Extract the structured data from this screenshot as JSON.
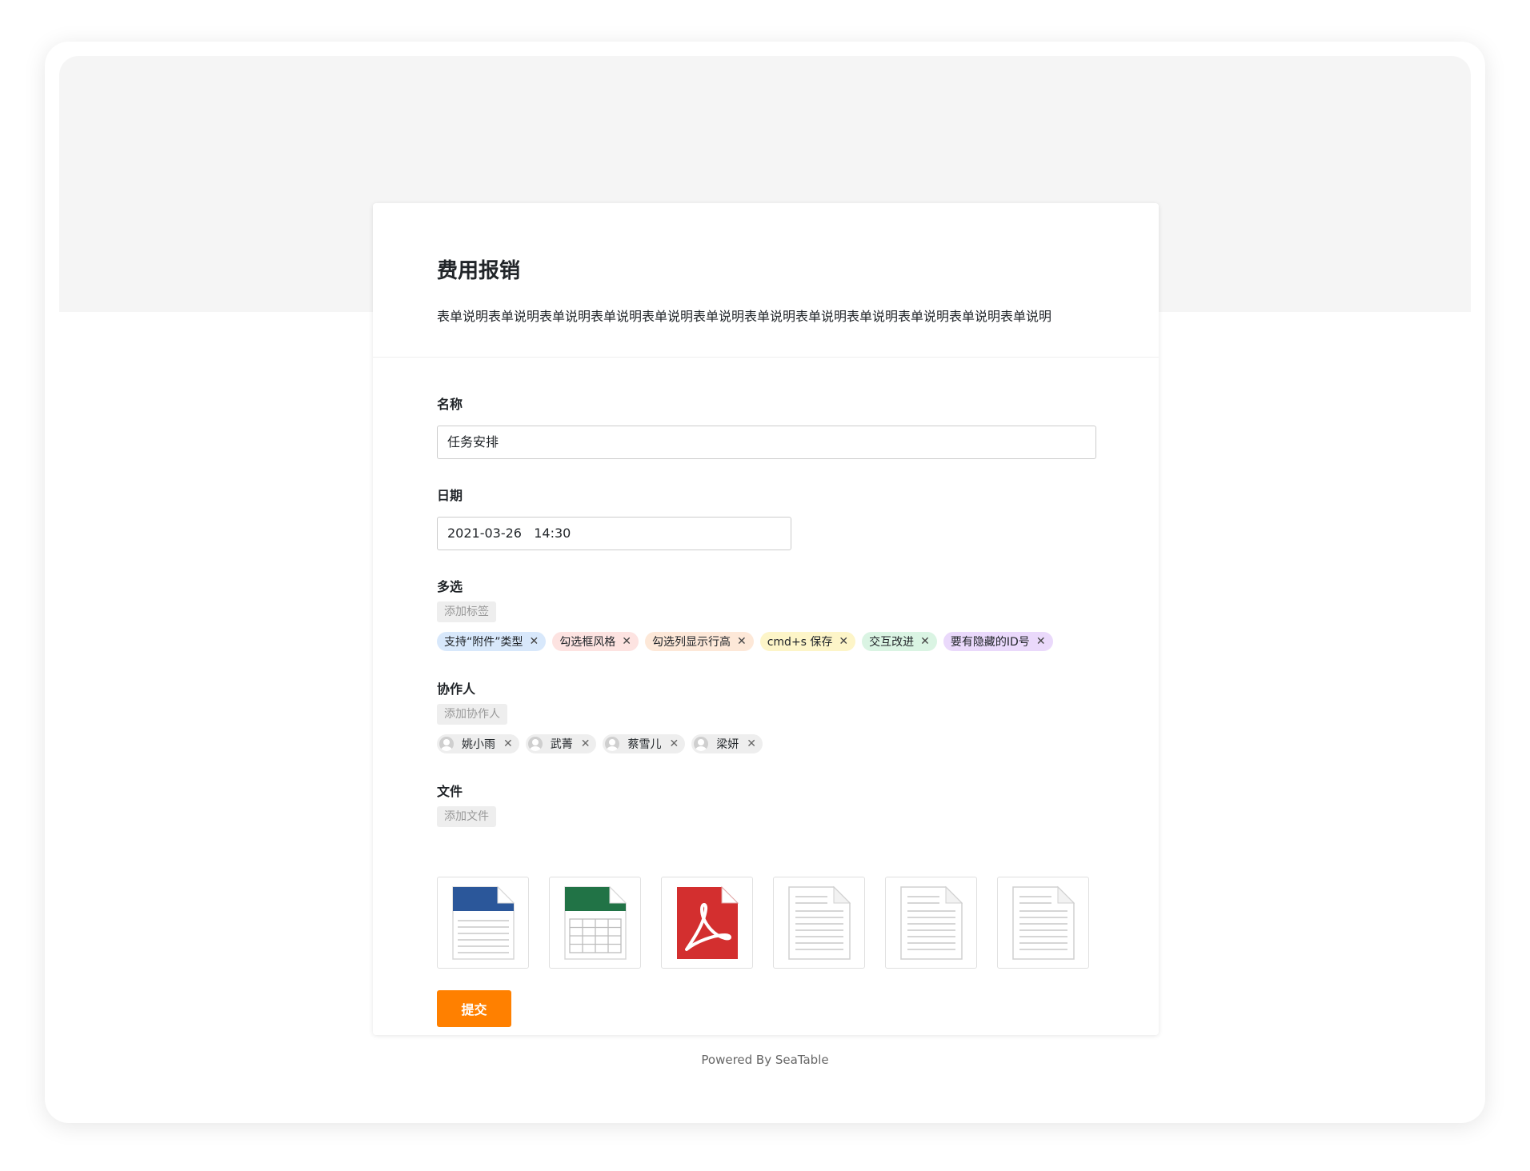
{
  "form": {
    "title": "费用报销",
    "description": "表单说明表单说明表单说明表单说明表单说明表单说明表单说明表单说明表单说明表单说明表单说明表单说明"
  },
  "fields": {
    "name": {
      "label": "名称",
      "value": "任务安排"
    },
    "date": {
      "label": "日期",
      "value": "2021-03-26   14:30"
    },
    "multi_select": {
      "label": "多选",
      "add_label": "添加标签",
      "tags": [
        {
          "text": "支持“附件”类型",
          "color": "#d8e8fb"
        },
        {
          "text": "勾选框风格",
          "color": "#fde3e1"
        },
        {
          "text": "勾选列显示行高",
          "color": "#fde8d8"
        },
        {
          "text": "cmd+s 保存",
          "color": "#fdf5c8"
        },
        {
          "text": "交互改进",
          "color": "#daf4e3"
        },
        {
          "text": "要有隐藏的ID号",
          "color": "#ead9fb"
        }
      ]
    },
    "collaborators": {
      "label": "协作人",
      "add_label": "添加协作人",
      "people": [
        "姚小雨",
        "武菁",
        "蔡雪儿",
        "梁妍"
      ]
    },
    "files": {
      "label": "文件",
      "add_label": "添加文件",
      "items": [
        {
          "type": "word-doc-icon"
        },
        {
          "type": "excel-sheet-icon"
        },
        {
          "type": "pdf-icon"
        },
        {
          "type": "generic-doc-icon"
        },
        {
          "type": "generic-doc-icon"
        },
        {
          "type": "generic-doc-icon"
        }
      ]
    }
  },
  "submit_label": "提交",
  "footer": "Powered By SeaTable",
  "colors": {
    "accent": "#ff8000",
    "word": "#2b579a",
    "excel": "#217346",
    "pdf": "#d32f2f"
  }
}
